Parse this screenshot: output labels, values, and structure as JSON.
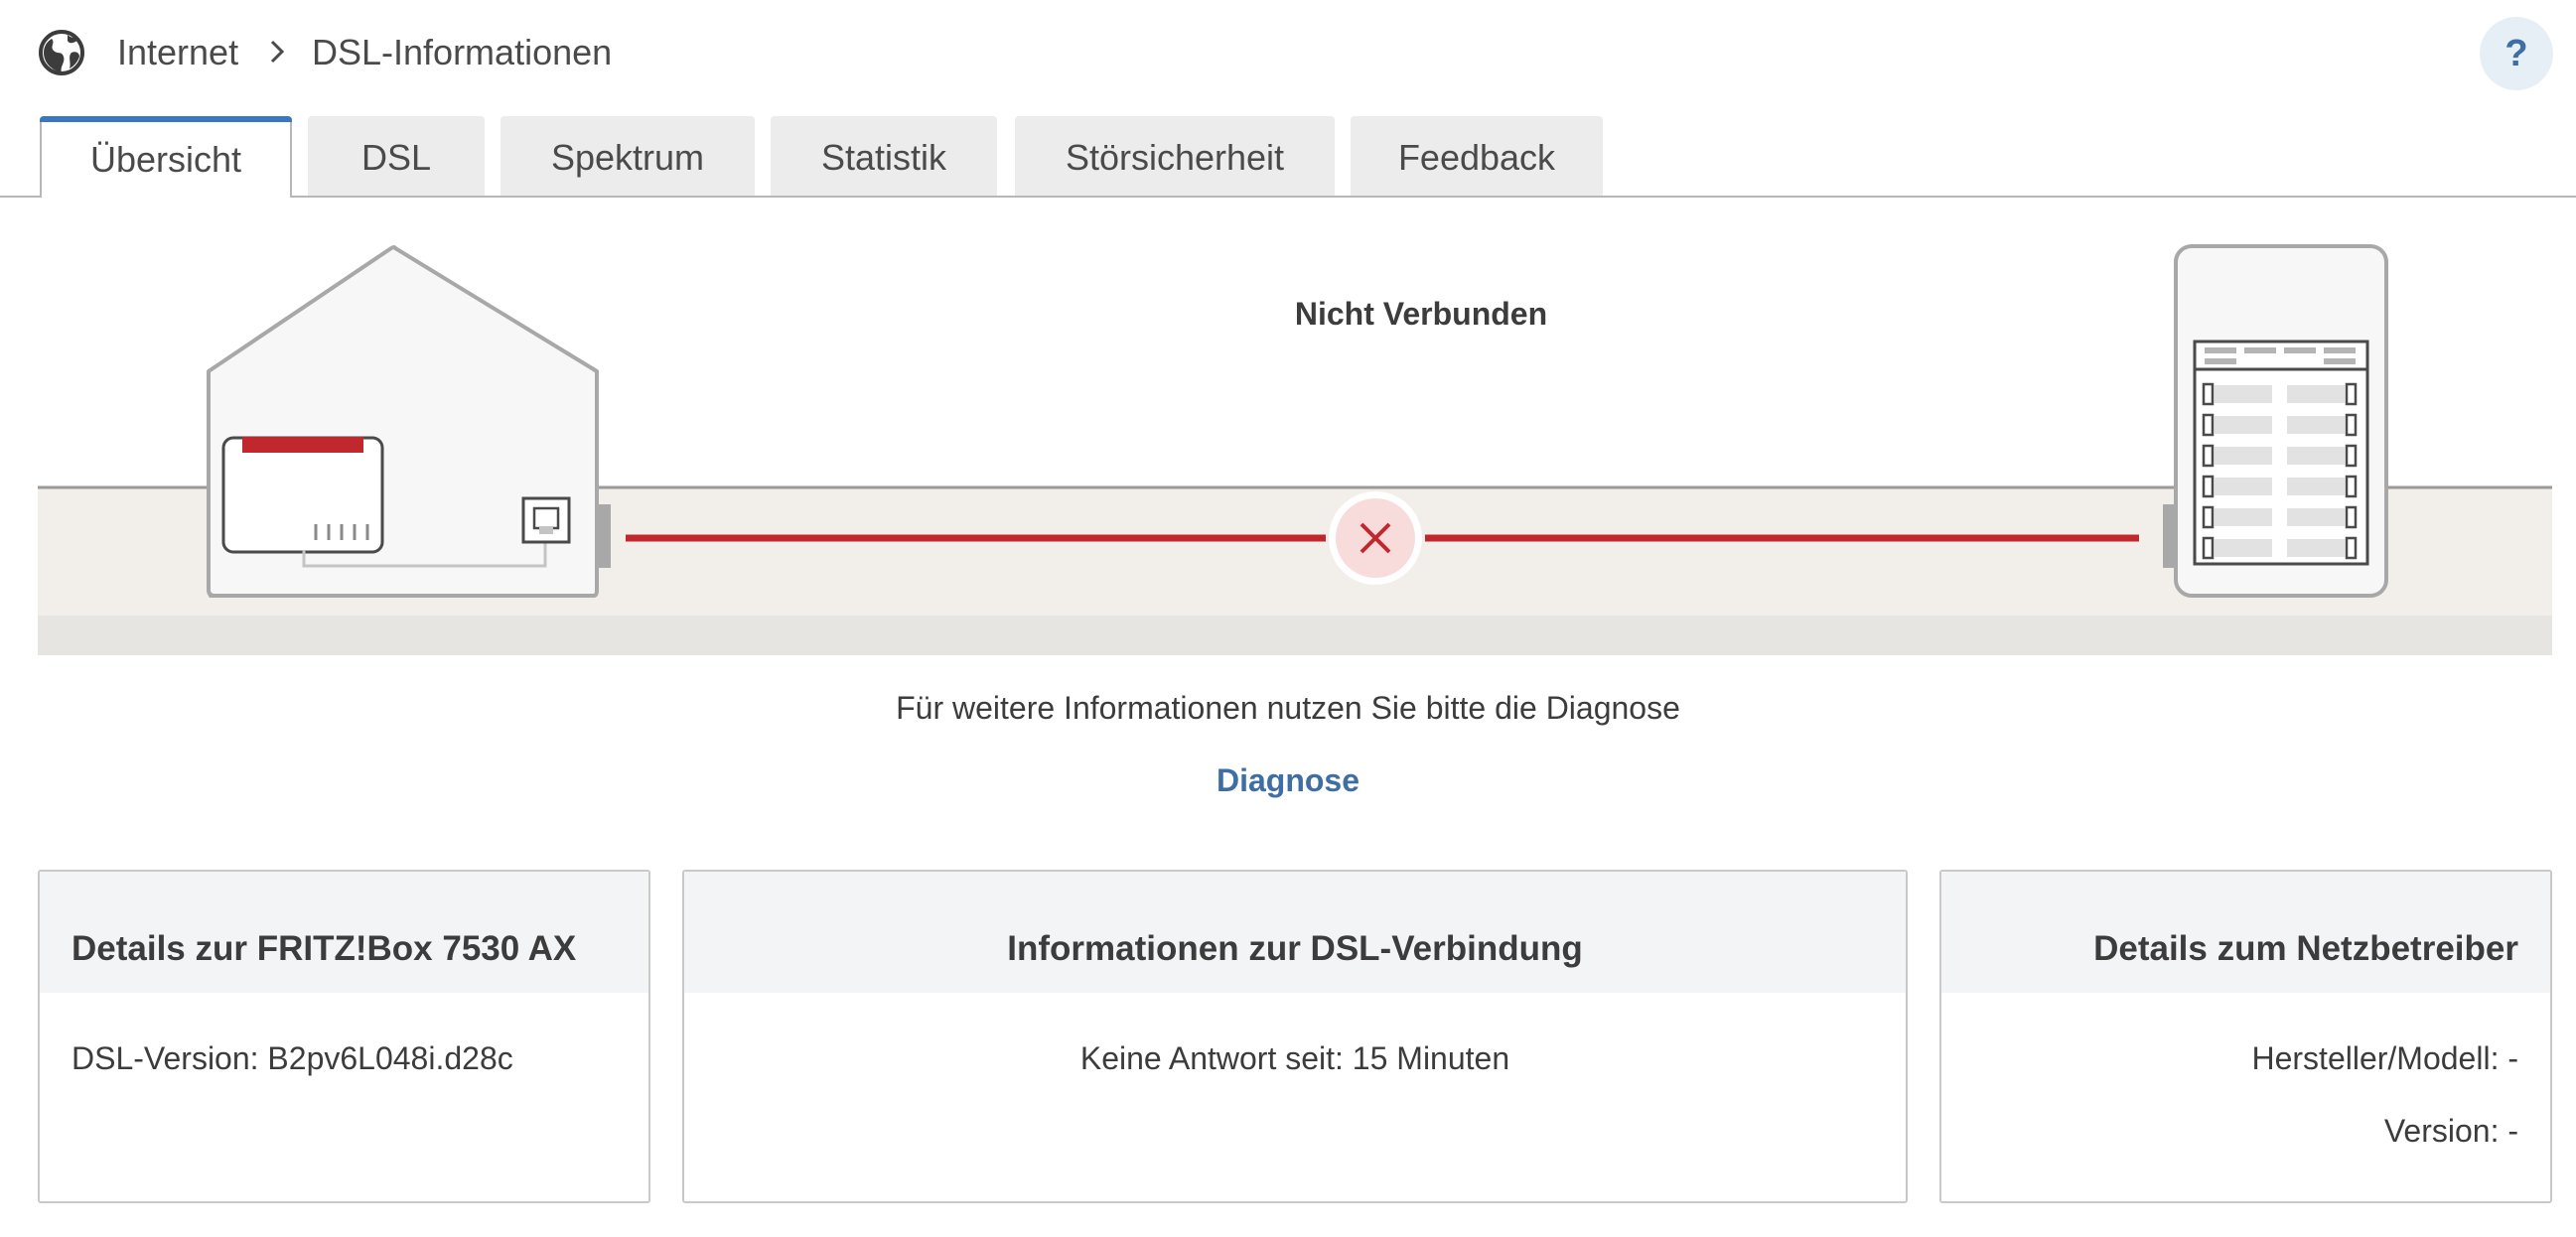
{
  "breadcrumb": {
    "items": [
      "Internet",
      "DSL-Informationen"
    ]
  },
  "help": {
    "label": "?"
  },
  "tabs": [
    {
      "label": "Übersicht",
      "active": true
    },
    {
      "label": "DSL",
      "active": false
    },
    {
      "label": "Spektrum",
      "active": false
    },
    {
      "label": "Statistik",
      "active": false
    },
    {
      "label": "Störsicherheit",
      "active": false
    },
    {
      "label": "Feedback",
      "active": false
    }
  ],
  "diagram": {
    "status": "Nicht Verbunden",
    "line_color": "#c0282d"
  },
  "info": {
    "text": "Für weitere Informationen nutzen Sie bitte die Diagnose",
    "link": "Diagnose"
  },
  "cards": [
    {
      "title": "Details zur FRITZ!Box 7530 AX",
      "lines": [
        "DSL-Version: B2pv6L048i.d28c"
      ]
    },
    {
      "title": "Informationen zur DSL-Verbindung",
      "lines": [
        "Keine Antwort seit: 15 Minuten"
      ]
    },
    {
      "title": "Details zum Netzbetreiber",
      "lines": [
        "Hersteller/Modell: -",
        "Version: -"
      ]
    }
  ],
  "colors": {
    "accent": "#3a77c0",
    "link": "#3f6ea5",
    "error": "#c0282d"
  }
}
